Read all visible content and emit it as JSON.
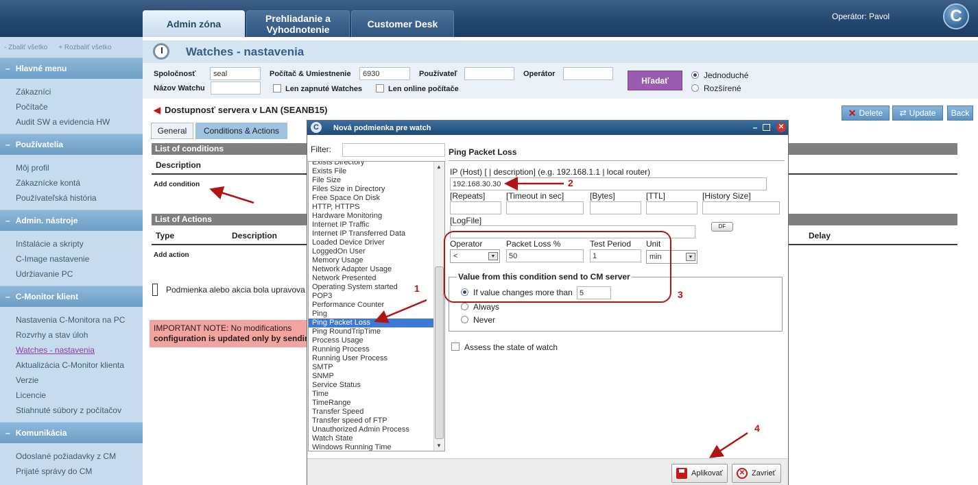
{
  "topbar": {
    "tabs": [
      {
        "label": "Admin zóna"
      },
      {
        "label": "Prehliadanie a Vyhodnotenie"
      },
      {
        "label": "Customer Desk"
      }
    ],
    "operator": "Operátor: Pavol",
    "logo_letter": "C"
  },
  "sidebar": {
    "collapse_all": "- Zbaliť všetko",
    "expand_all": "+ Rozbaliť všetko",
    "sections": [
      {
        "title": "Hlavné menu",
        "items": [
          "Zákazníci",
          "Počítače",
          "Audit SW a evidencia HW"
        ]
      },
      {
        "title": "Používatelia",
        "items": [
          "Môj profil",
          "Zákaznícke kontá",
          "Používateľská história"
        ]
      },
      {
        "title": "Admin. nástroje",
        "items": [
          "Inštalácie a skripty",
          "C-Image nastavenie",
          "Udržiavanie PC"
        ]
      },
      {
        "title": "C-Monitor klient",
        "items": [
          "Nastavenia C-Monitora na PC",
          "Rozvrhy a stav úloh",
          "Watches - nastavenia",
          "Aktualizácia C-Monitor klienta",
          "Verzie",
          "Licencie",
          "Stiahnuté súbory z počítačov"
        ]
      },
      {
        "title": "Komunikácia",
        "items": [
          "Odoslané požiadavky z CM",
          "Prijaté správy do CM"
        ]
      }
    ],
    "current_item": "Watches - nastavenia"
  },
  "page": {
    "title": "Watches - nastavenia"
  },
  "filter": {
    "company_label": "Spoločnosť",
    "company_value": "seal",
    "computer_label": "Počítač & Umiestnenie",
    "computer_value": "6930",
    "user_label": "Používateľ",
    "user_value": "",
    "operator_label": "Operátor",
    "operator_value": "",
    "watch_name_label": "Názov Watchu",
    "watch_name_value": "",
    "only_enabled_label": "Len zapnuté Watches",
    "only_online_label": "Len online počítače",
    "search_button": "Hľadať",
    "mode_simple": "Jednoduché",
    "mode_extended": "Rozšírené",
    "mode_selected": "Jednoduché"
  },
  "watch": {
    "title": "Dostupnosť servera v LAN (SEANB15)",
    "buttons": {
      "delete": "Delete",
      "update": "Update",
      "back": "Back"
    },
    "tabs": [
      "General",
      "Conditions & Actions"
    ],
    "active_tab": "Conditions & Actions",
    "conditions_header": "List of conditions",
    "conditions_col": "Description",
    "add_condition": "Add condition",
    "actions_header": "List of Actions",
    "actions_cols": [
      "Type",
      "Description",
      "Delay"
    ],
    "add_action": "Add action",
    "modified_note": "Podmienka alebo akcia bola upravova",
    "important_line1": "IMPORTANT  NOTE:  No  modifications",
    "important_line2": "configuration is updated only by sending"
  },
  "dialog": {
    "title": "Nová podmienka pre watch",
    "filter_label": "Filter:",
    "filter_value": "",
    "types": [
      "Exists Directory",
      "Exists File",
      "File Size",
      "Files Size in Directory",
      "Free Space On Disk",
      "HTTP, HTTPS",
      "Hardware Monitoring",
      "Internet IP Traffic",
      "Internet IP Transferred Data",
      "Loaded Device Driver",
      "LoggedOn User",
      "Memory Usage",
      "Network Adapter Usage",
      "Network Presented",
      "Operating System started",
      "POP3",
      "Performance Counter",
      "Ping",
      "Ping Packet Loss",
      "Ping RoundTripTime",
      "Process Usage",
      "Running Process",
      "Running User Process",
      "SMTP",
      "SNMP",
      "Service Status",
      "Time",
      "TimeRange",
      "Transfer Speed",
      "Transfer speed of FTP",
      "Unauthorized Admin Process",
      "Watch State",
      "Windows Running Time"
    ],
    "selected_type": "Ping Packet Loss",
    "form": {
      "section_title": "Ping Packet Loss",
      "ip_label": "IP (Host) [ | description] (e.g. 192.168.1.1 | local router)",
      "ip_value": "192.168.30.30",
      "repeats_label": "[Repeats]",
      "timeout_label": "[Timeout in sec]",
      "bytes_label": "[Bytes]",
      "ttl_label": "[TTL]",
      "history_label": "[History Size]",
      "logfile_label": "[LogFile]",
      "df_button": "DF",
      "operator_label": "Operator",
      "operator_value": "<",
      "packet_loss_label": "Packet Loss %",
      "packet_loss_value": "50",
      "test_period_label": "Test Period",
      "test_period_value": "1",
      "unit_label": "Unit",
      "unit_value": "min",
      "send_legend": "Value from this condition send to CM server",
      "send_if_changes": "If value changes more than",
      "send_if_changes_value": "5",
      "send_always": "Always",
      "send_never": "Never",
      "send_selected": "If value changes more than",
      "assess_label": "Assess the state of watch"
    },
    "apply_button": "Aplikovať",
    "close_button": "Zavrieť"
  },
  "annotations": [
    "1",
    "2",
    "3",
    "4"
  ],
  "colors": {
    "topbar": "#23466f",
    "sidebar": "#c6dcee",
    "accent_purple": "#9a5bb1",
    "annotation_red": "#b01515",
    "selection_blue": "#3f77d6"
  }
}
